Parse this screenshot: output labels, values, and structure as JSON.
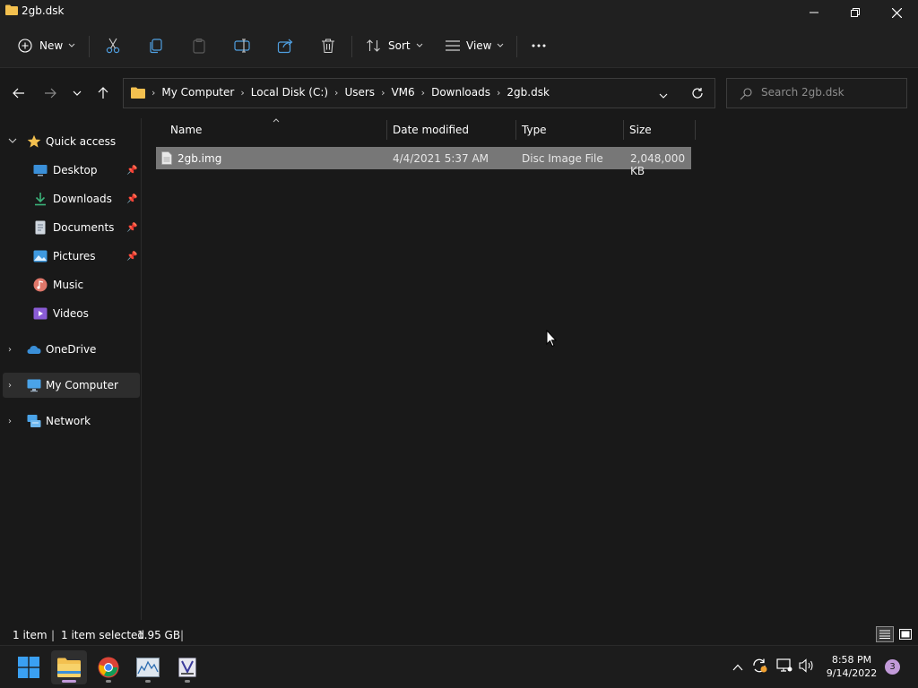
{
  "window": {
    "title": "2gb.dsk"
  },
  "toolbar": {
    "new_label": "New",
    "sort_label": "Sort",
    "view_label": "View",
    "more_label": "···"
  },
  "address": {
    "crumbs": [
      "My Computer",
      "Local Disk (C:)",
      "Users",
      "VM6",
      "Downloads",
      "2gb.dsk"
    ]
  },
  "search": {
    "placeholder": "Search 2gb.dsk"
  },
  "navpane": {
    "quick_access": "Quick access",
    "items": [
      "Desktop",
      "Downloads",
      "Documents",
      "Pictures",
      "Music",
      "Videos"
    ],
    "onedrive": "OneDrive",
    "mycomputer": "My Computer",
    "network": "Network"
  },
  "columns": {
    "name": "Name",
    "date": "Date modified",
    "type": "Type",
    "size": "Size"
  },
  "files": [
    {
      "name": "2gb.img",
      "date": "4/4/2021 5:37 AM",
      "type": "Disc Image File",
      "size": "2,048,000 KB"
    }
  ],
  "status": {
    "count": "1 item",
    "selected": "1 item selected",
    "size": "1.95 GB"
  },
  "taskbar": {
    "time": "8:58 PM",
    "date": "9/14/2022",
    "notifications": "3"
  },
  "colors": {
    "accent": "#f3c04f",
    "selection": "#777777",
    "badge": "#c29ad9"
  }
}
